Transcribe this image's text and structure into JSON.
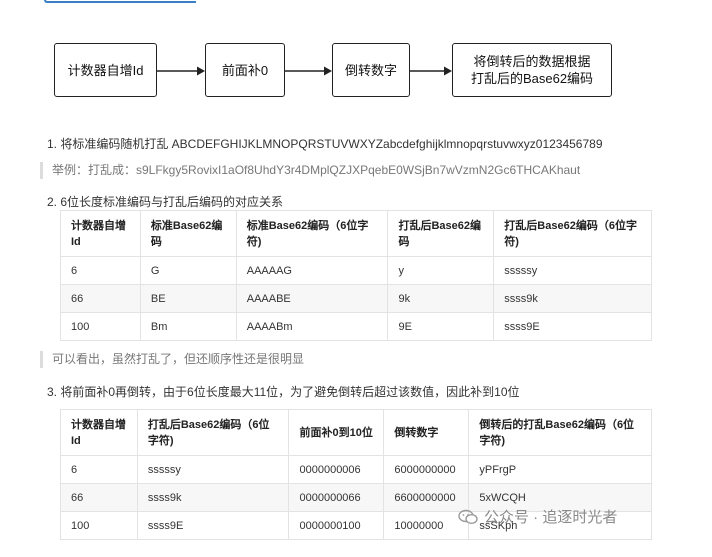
{
  "flowchart": {
    "boxes": [
      "计数器自增Id",
      "前面补0",
      "倒转数字",
      "将倒转后的数据根据\n打乱后的Base62编码"
    ]
  },
  "steps": {
    "step1": "1. 将标准编码随机打乱 ABCDEFGHIJKLMNOPQRSTUVWXYZabcdefghijklmnopqrstuvwxyz0123456789",
    "example": "举例：打乱成：s9LFkgy5RovixI1aOf8UhdY3r4DMplQZJXPqebE0WSjBn7wVzmN2Gc6THCAKhaut",
    "step2": "2. 6位长度标准编码与打乱后编码的对应关系",
    "note": "可以看出，虽然打乱了，但还顺序性还是很明显",
    "step3": "3. 将前面补0再倒转，由于6位长度最大11位，为了避免倒转后超过该数值，因此补到10位"
  },
  "table1": {
    "headers": [
      "计数器自增Id",
      "标准Base62编码",
      "标准Base62编码（6位字符)",
      "打乱后Base62编码",
      "打乱后Base62编码（6位字符)"
    ],
    "rows": [
      [
        "6",
        "G",
        "AAAAAG",
        "y",
        "sssssy"
      ],
      [
        "66",
        "BE",
        "AAAABE",
        "9k",
        "ssss9k"
      ],
      [
        "100",
        "Bm",
        "AAAABm",
        "9E",
        "ssss9E"
      ]
    ]
  },
  "table2": {
    "headers": [
      "计数器自增Id",
      "打乱后Base62编码（6位字符)",
      "前面补0到10位",
      "倒转数字",
      "倒转后的打乱Base62编码（6位字符)"
    ],
    "rows": [
      [
        "6",
        "sssssy",
        "0000000006",
        "6000000000",
        "yPFrgP"
      ],
      [
        "66",
        "ssss9k",
        "0000000066",
        "6600000000",
        "5xWCQH"
      ],
      [
        "100",
        "ssss9E",
        "0000000100",
        "10000000",
        "ssSKph"
      ]
    ]
  },
  "watermark": {
    "text": "公众号 · 追逐时光者",
    "icon": "wechat-icon"
  }
}
